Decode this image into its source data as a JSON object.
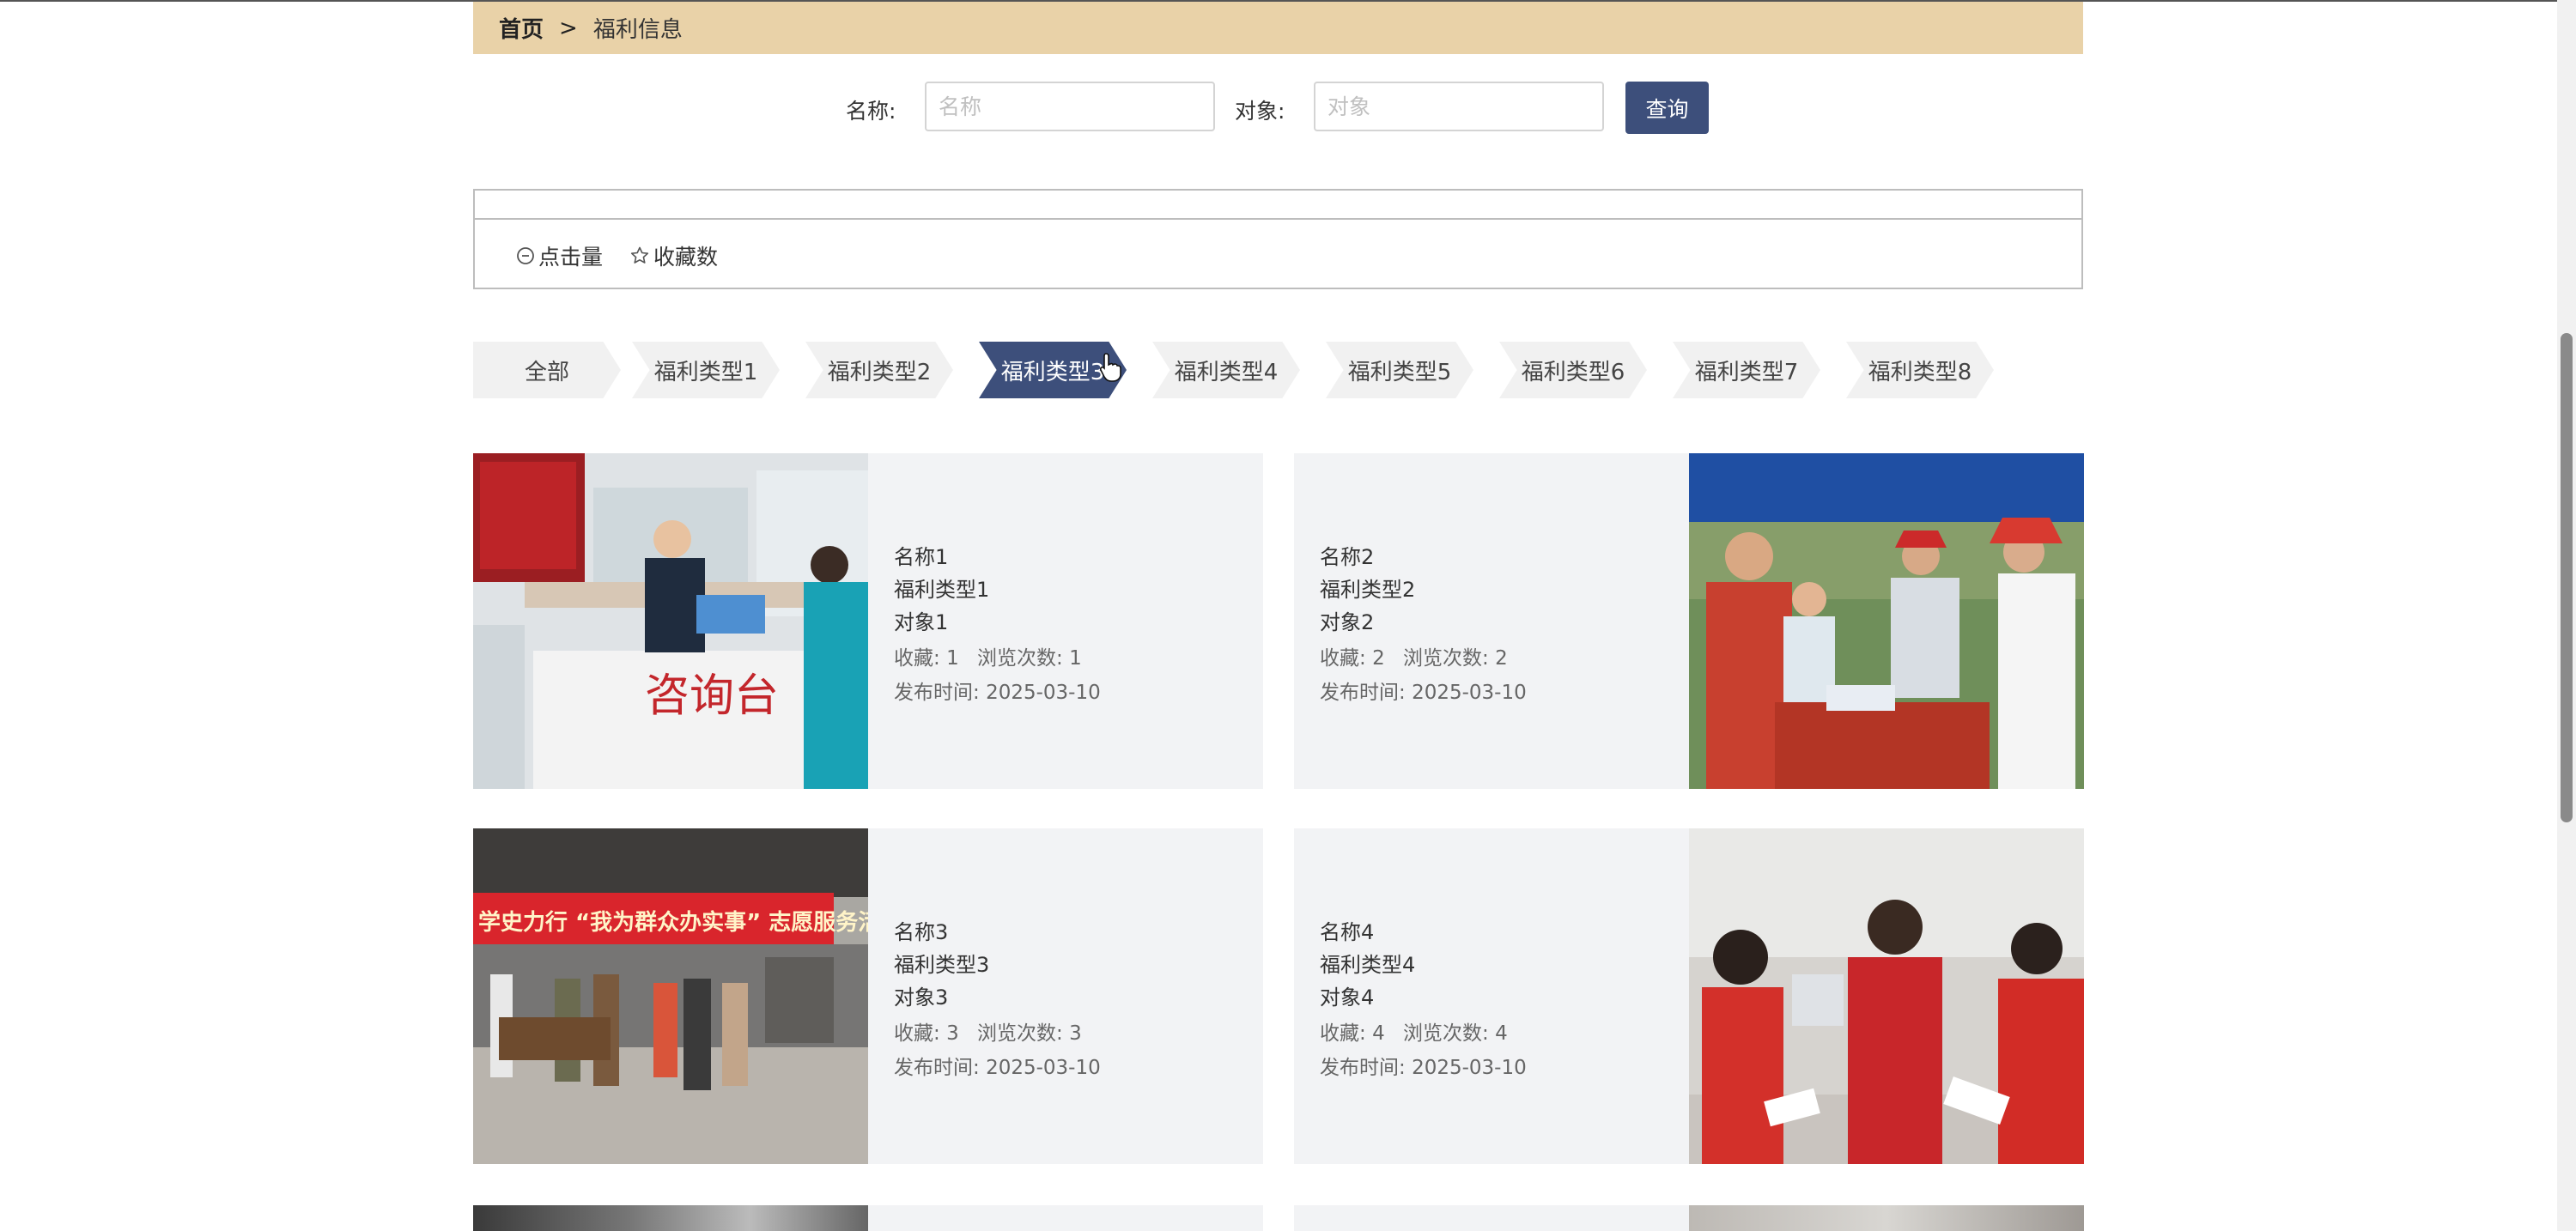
{
  "breadcrumb": {
    "home": "首页",
    "separator": ">",
    "current": "福利信息"
  },
  "search": {
    "name_label": "名称:",
    "name_placeholder": "名称",
    "name_value": "",
    "target_label": "对象:",
    "target_placeholder": "对象",
    "target_value": "",
    "query_button": "查询"
  },
  "sort": {
    "clicks": {
      "label": "点击量",
      "icon": "clock-icon"
    },
    "favorites": {
      "label": "收藏数",
      "icon": "star-icon"
    }
  },
  "categories": [
    {
      "label": "全部",
      "active": false
    },
    {
      "label": "福利类型1",
      "active": false
    },
    {
      "label": "福利类型2",
      "active": false
    },
    {
      "label": "福利类型3",
      "active": true
    },
    {
      "label": "福利类型4",
      "active": false
    },
    {
      "label": "福利类型5",
      "active": false
    },
    {
      "label": "福利类型6",
      "active": false
    },
    {
      "label": "福利类型7",
      "active": false
    },
    {
      "label": "福利类型8",
      "active": false
    }
  ],
  "cards": [
    {
      "name": "名称1",
      "type": "福利类型1",
      "target": "对象1",
      "fav_label": "收藏:",
      "fav": "1",
      "views_label": "浏览次数:",
      "views": "1",
      "time_label": "发布时间:",
      "time": "2025-03-10",
      "image": "consultation-desk-photo"
    },
    {
      "name": "名称2",
      "type": "福利类型2",
      "target": "对象2",
      "fav_label": "收藏:",
      "fav": "2",
      "views_label": "浏览次数:",
      "views": "2",
      "time_label": "发布时间:",
      "time": "2025-03-10",
      "image": "outdoor-service-photo"
    },
    {
      "name": "名称3",
      "type": "福利类型3",
      "target": "对象3",
      "fav_label": "收藏:",
      "fav": "3",
      "views_label": "浏览次数:",
      "views": "3",
      "time_label": "发布时间:",
      "time": "2025-03-10",
      "image": "volunteer-tent-photo"
    },
    {
      "name": "名称4",
      "type": "福利类型4",
      "target": "对象4",
      "fav_label": "收藏:",
      "fav": "4",
      "views_label": "浏览次数:",
      "views": "4",
      "time_label": "发布时间:",
      "time": "2025-03-10",
      "image": "home-visit-photo"
    }
  ],
  "banners": {
    "desk_sign": "咨询台",
    "volunteer_banner": "学史力行 “我为群众办实事” 志愿服务活动"
  },
  "colors": {
    "accent": "#3d4f7b",
    "breadcrumb_bg": "#e9d2a8",
    "card_bg": "#f2f3f5",
    "chevron_bg": "#f1f1f1"
  }
}
